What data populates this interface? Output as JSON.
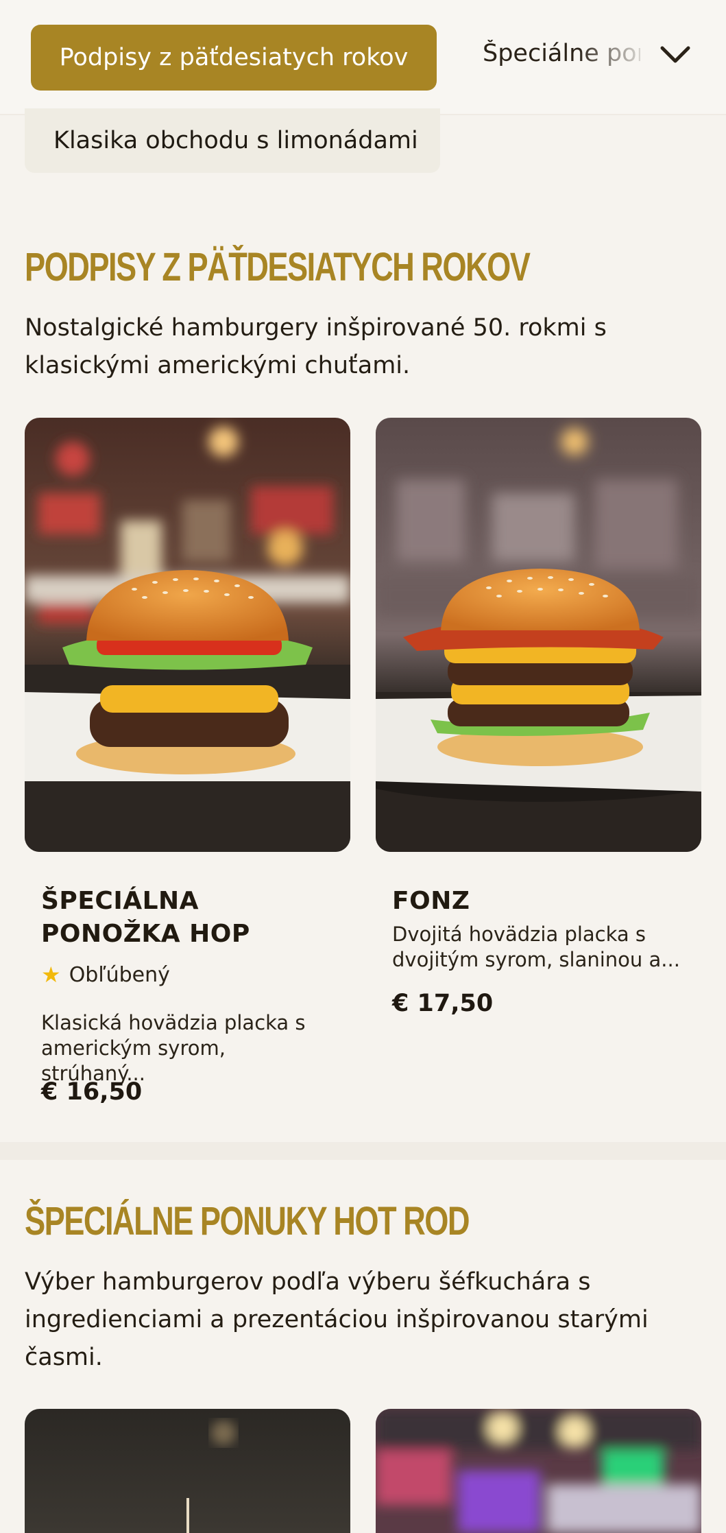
{
  "category_nav": {
    "active_label": "Podpisy z päťdesiatych rokov",
    "next_label": "Špeciálne ponuky Hot Rod",
    "sub_label": "Klasika obchodu s limonádami"
  },
  "sections": [
    {
      "title": "PODPISY Z PÄŤDESIATYCH ROKOV",
      "description": "Nostalgické hamburgery inšpirované 50. rokmi s klasickými americkými chuťami.",
      "items": [
        {
          "name": "ŠPECIÁLNA PONOŽKA HOP",
          "badge": "Obľúbený",
          "description": "Klasická hovädzia placka s americkým syrom, strúhaný...",
          "price": "€ 16,50"
        },
        {
          "name": "FONZ",
          "description": "Dvojitá hovädzia placka s dvojitým syrom, slaninou a...",
          "price": "€ 17,50"
        }
      ]
    },
    {
      "title": "ŠPECIÁLNE PONUKY HOT ROD",
      "description": "Výber hamburgerov podľa výberu šéfkuchára s ingredienciami a prezentáciou inšpirovanou starými časmi."
    }
  ],
  "colors": {
    "accent": "#a88524",
    "background": "#f6f3ee",
    "star": "#f2b90c"
  }
}
